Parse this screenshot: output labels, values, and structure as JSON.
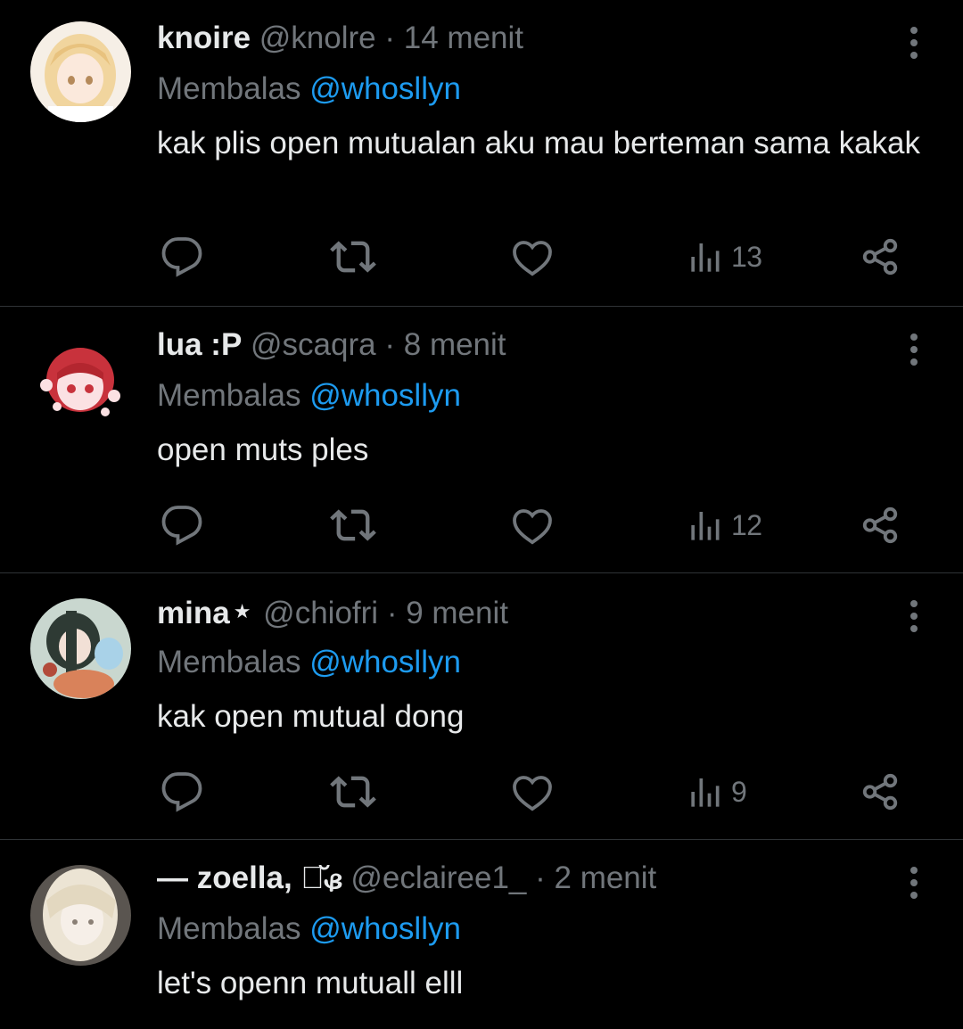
{
  "replies": [
    {
      "name": "knoire",
      "badge": "",
      "handle": "@knolre",
      "time": "14 menit",
      "replying_prefix": "Membalas",
      "replying_to": "@whosllyn",
      "text": "kak plis open mutualan aku mau berteman sama kakak",
      "views": "13",
      "avatar_color": "#f2dfc2"
    },
    {
      "name": "lua :P",
      "badge": "",
      "handle": "@scaqra",
      "time": "8 menit",
      "replying_prefix": "Membalas",
      "replying_to": "@whosllyn",
      "text": "open muts ples",
      "views": "12",
      "avatar_color": "#c8323c"
    },
    {
      "name": "mina",
      "badge": "★",
      "handle": "@chiofri",
      "time": "9 menit",
      "replying_prefix": "Membalas",
      "replying_to": "@whosllyn",
      "text": "kak open mutual dong",
      "views": "9",
      "avatar_color": "#7f9a8a"
    },
    {
      "name": "— zoella, ঌ̆ᏸ",
      "badge": "",
      "handle": "@eclairee1_",
      "time": "2 menit",
      "replying_prefix": "Membalas",
      "replying_to": "@whosllyn",
      "text": "let's openn mutuall elll",
      "views": "",
      "avatar_color": "#e9e4dc"
    }
  ],
  "separator": "·",
  "icons": {
    "reply": "reply-icon",
    "retweet": "retweet-icon",
    "like": "heart-icon",
    "views": "views-chart-icon",
    "share": "share-icon",
    "more": "more-vertical-icon"
  },
  "colors": {
    "background": "#000000",
    "text": "#e7e9ea",
    "muted": "#71767b",
    "link": "#1d9bf0",
    "divider": "#2f3336"
  }
}
